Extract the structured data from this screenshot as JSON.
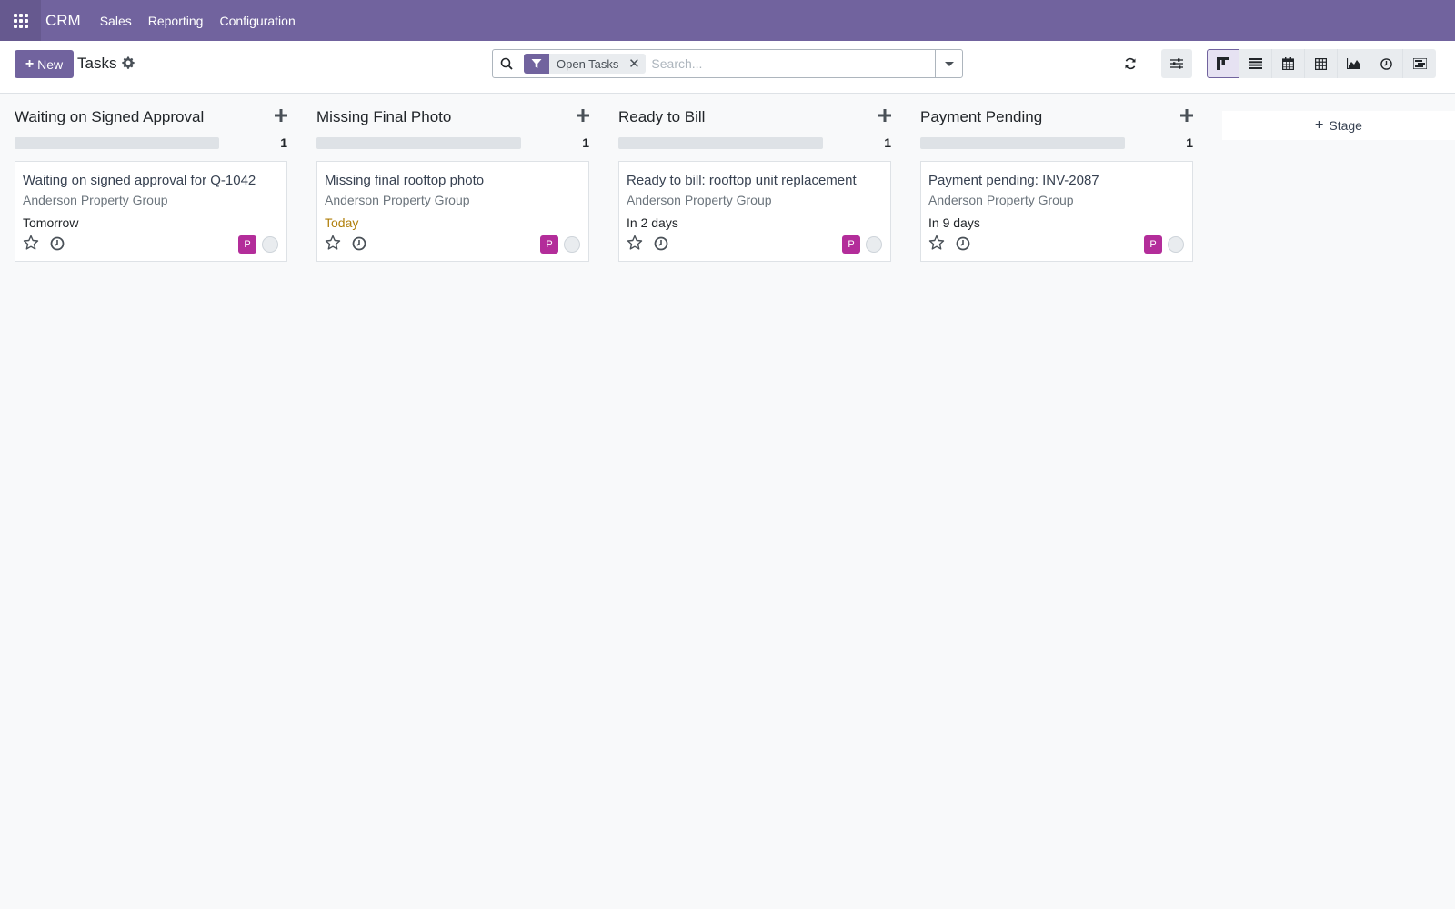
{
  "navbar": {
    "app_name": "CRM",
    "menu": [
      "Sales",
      "Reporting",
      "Configuration"
    ]
  },
  "control": {
    "new_label": "New",
    "title": "Tasks",
    "search": {
      "facet": "Open Tasks",
      "placeholder": "Search..."
    }
  },
  "columns": [
    {
      "name": "Waiting on Signed Approval",
      "count": "1",
      "card": {
        "title": "Waiting on signed approval for Q-1042",
        "partner": "Anderson Property Group",
        "date": "Tomorrow",
        "avatar": "P"
      }
    },
    {
      "name": "Missing Final Photo",
      "count": "1",
      "card": {
        "title": "Missing final rooftop photo",
        "partner": "Anderson Property Group",
        "date": "Today",
        "avatar": "P"
      }
    },
    {
      "name": "Ready to Bill",
      "count": "1",
      "card": {
        "title": "Ready to bill: rooftop unit replacement",
        "partner": "Anderson Property Group",
        "date": "In 2 days",
        "avatar": "P"
      }
    },
    {
      "name": "Payment Pending",
      "count": "1",
      "card": {
        "title": "Payment pending: INV-2087",
        "partner": "Anderson Property Group",
        "date": "In 9 days",
        "avatar": "P"
      }
    }
  ],
  "add_stage_label": "Stage",
  "colors": {
    "brand": "#71639e",
    "avatar": "#b32d9a",
    "today": "#b07f0b"
  }
}
